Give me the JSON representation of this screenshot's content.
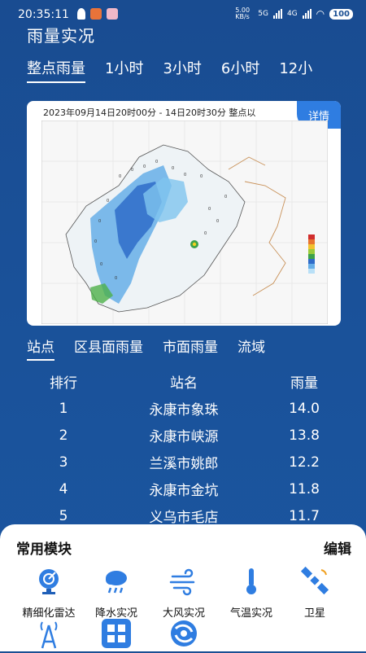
{
  "status": {
    "time": "20:35:11",
    "net_speed": "5.00 KB/s",
    "net_1": "5G",
    "net_2": "4G",
    "battery": "100"
  },
  "page_title": "雨量实况",
  "tabs": [
    "整点雨量",
    "1小时",
    "3小时",
    "6小时",
    "12小"
  ],
  "map": {
    "title": "2023年09月14日20时00分 - 14日20时30分   整点以",
    "detail_label": "详情"
  },
  "sub_tabs": [
    "站点",
    "区县面雨量",
    "市面雨量",
    "流域"
  ],
  "table": {
    "headers": [
      "排行",
      "站名",
      "雨量"
    ],
    "rows": [
      {
        "rank": "1",
        "name": "永康市象珠",
        "value": "14.0"
      },
      {
        "rank": "2",
        "name": "永康市峡源",
        "value": "13.8"
      },
      {
        "rank": "3",
        "name": "兰溪市姚郎",
        "value": "12.2"
      },
      {
        "rank": "4",
        "name": "永康市金坑",
        "value": "11.8"
      },
      {
        "rank": "5",
        "name": "义乌市毛店",
        "value": "11.7"
      }
    ]
  },
  "modules": {
    "title": "常用模块",
    "edit": "编辑",
    "items": [
      {
        "label": "精细化雷达",
        "icon": "radar-dish-icon"
      },
      {
        "label": "降水实况",
        "icon": "rain-cloud-icon"
      },
      {
        "label": "大风实况",
        "icon": "wind-icon"
      },
      {
        "label": "气温实况",
        "icon": "thermometer-icon"
      },
      {
        "label": "卫星",
        "icon": "satellite-icon"
      },
      {
        "label": "",
        "icon": "signal-tower-icon"
      },
      {
        "label": "",
        "icon": "grid-apps-icon"
      },
      {
        "label": "",
        "icon": "typhoon-icon"
      }
    ]
  }
}
